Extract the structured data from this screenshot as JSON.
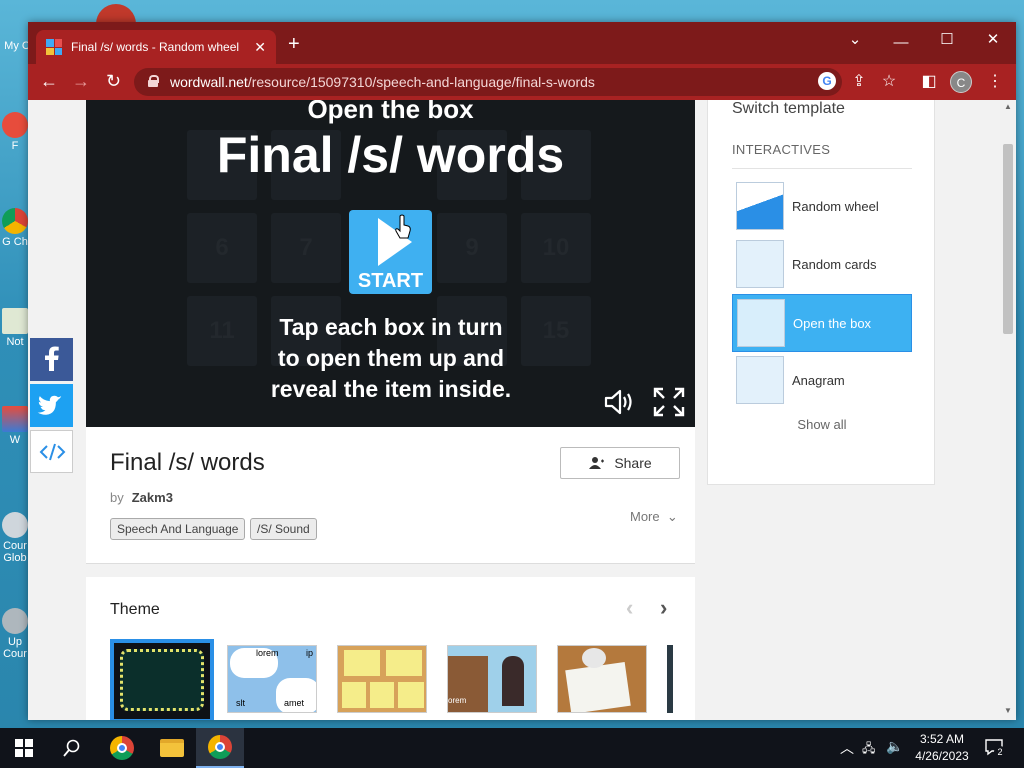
{
  "desktop": {
    "icons": [
      {
        "label": "My C"
      },
      {
        "label": "F"
      },
      {
        "label": "G Ch"
      },
      {
        "label": "Not"
      },
      {
        "label": "W"
      },
      {
        "label": "Cour Glob"
      },
      {
        "label": "Up Cour"
      }
    ]
  },
  "browser": {
    "tab_title": "Final /s/ words - Random wheel",
    "tab_close": "✕",
    "new_tab": "+",
    "url_domain": "wordwall.net",
    "url_path": "/resource/15097310/speech-and-language/final-s-words",
    "profile_initial": "C",
    "accent": "#a82222"
  },
  "game": {
    "subtitle": "Open the box",
    "title": "Final /s/ words",
    "start_label": "START",
    "instruction_lines": [
      "Tap each box in turn",
      "to open them up and",
      "reveal the item inside."
    ],
    "box_numbers": [
      "6",
      "7",
      "9",
      "10",
      "11",
      "15"
    ]
  },
  "activity": {
    "title": "Final /s/ words",
    "by_label": "by",
    "author": "Zakm3",
    "share_label": "Share",
    "more_label": "More",
    "tags": [
      "Speech And Language",
      "/S/ Sound"
    ]
  },
  "theme": {
    "heading": "Theme",
    "thumb_texts": {
      "lorem": "lorem",
      "ip": "ip",
      "slt": "slt",
      "amet": "amet",
      "orem": "orem"
    }
  },
  "sidebar": {
    "switch_label": "Switch template",
    "section_label": "INTERACTIVES",
    "templates": [
      {
        "label": "Random wheel",
        "active": false
      },
      {
        "label": "Random cards",
        "active": false
      },
      {
        "label": "Open the box",
        "active": true
      },
      {
        "label": "Anagram",
        "active": false
      }
    ],
    "show_all": "Show all"
  },
  "taskbar": {
    "time": "3:52 AM",
    "date": "4/26/2023",
    "notification_count": "2"
  }
}
